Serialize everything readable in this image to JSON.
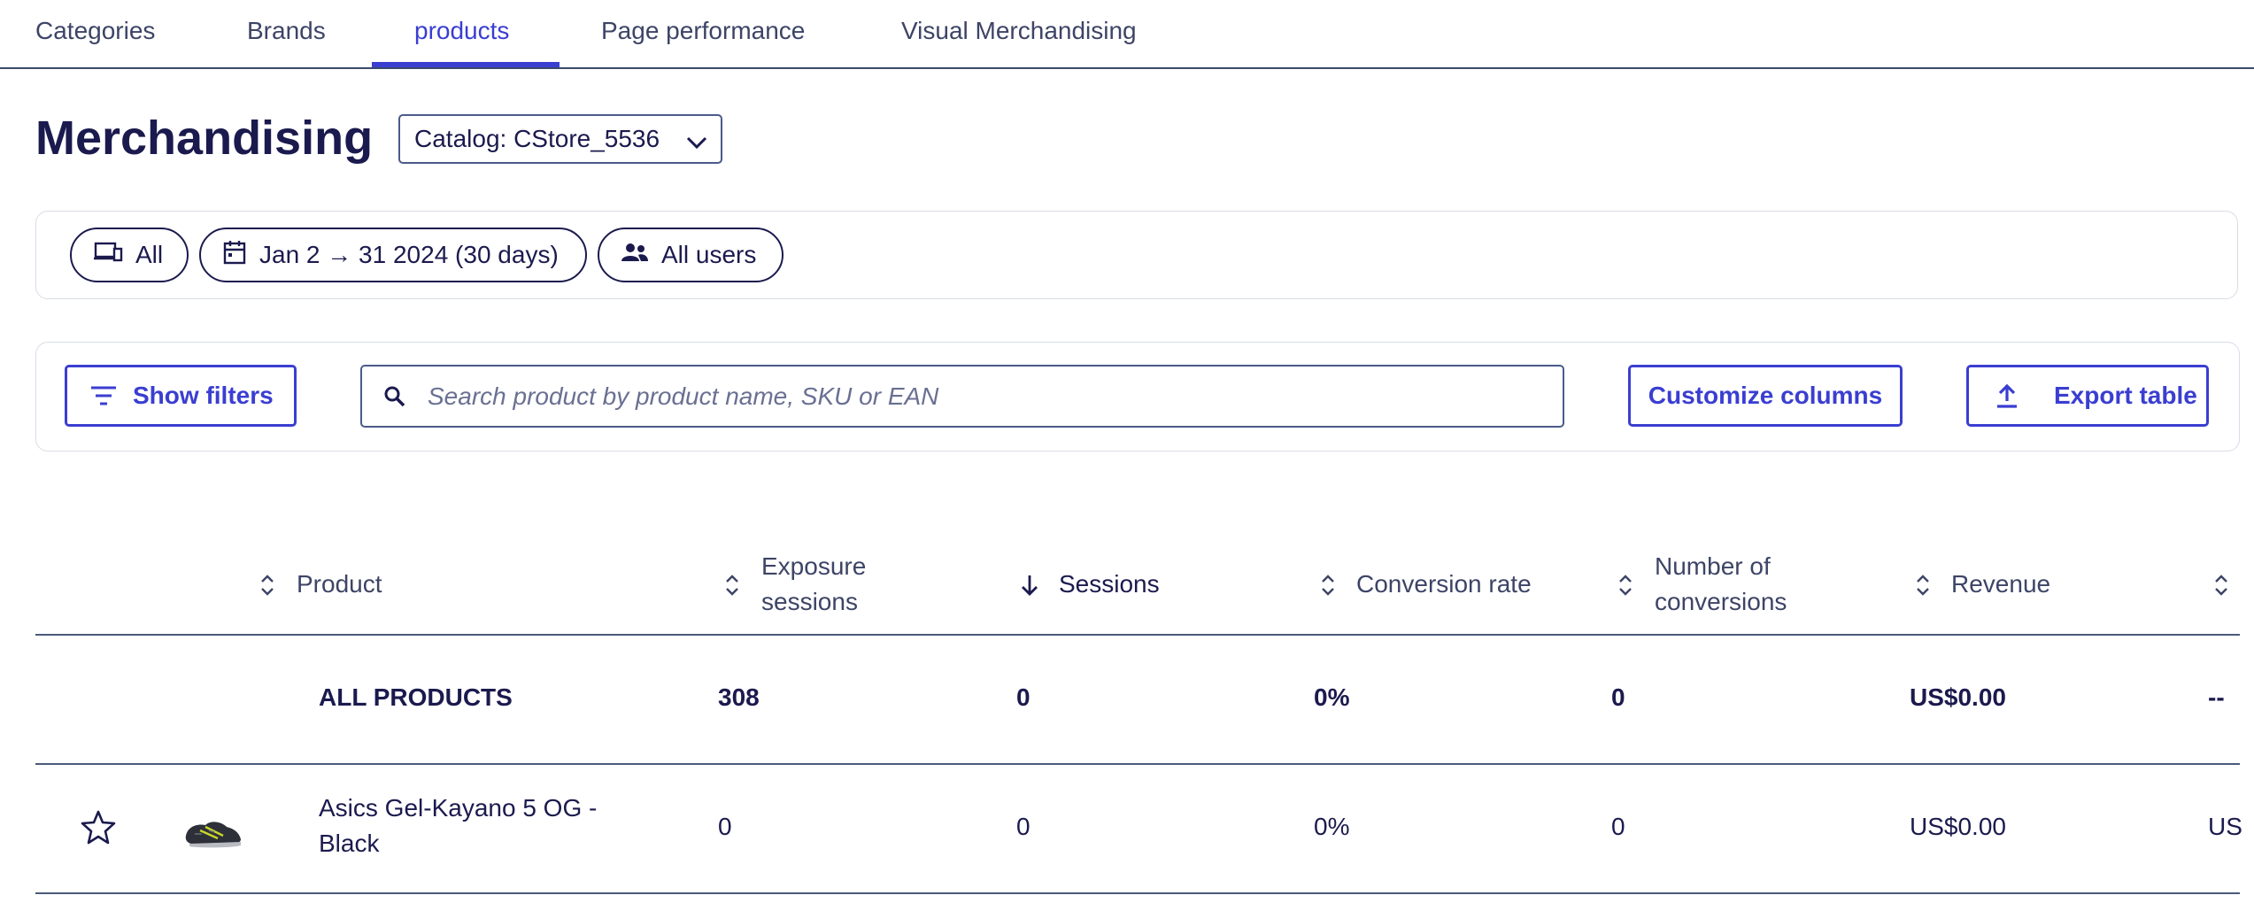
{
  "tabs": [
    {
      "label": "Categories"
    },
    {
      "label": "Brands"
    },
    {
      "label": "products",
      "active": true
    },
    {
      "label": "Page performance"
    },
    {
      "label": "Visual Merchandising"
    }
  ],
  "page": {
    "title": "Merchandising",
    "catalog_label": "Catalog: CStore_5536"
  },
  "filters": {
    "device": "All",
    "date_range": "Jan 2 → 31 2024 (30 days)",
    "audience": "All users"
  },
  "toolbar": {
    "show_filters": "Show filters",
    "search_placeholder": "Search product by product name, SKU or EAN",
    "search_value": "",
    "customize_columns": "Customize columns",
    "export_table": "Export table"
  },
  "table": {
    "columns": [
      {
        "label": "Product",
        "sort": "none"
      },
      {
        "label": "Exposure sessions",
        "sort": "none"
      },
      {
        "label": "Sessions",
        "sort": "descending"
      },
      {
        "label": "Conversion rate",
        "sort": "none"
      },
      {
        "label": "Number of conversions",
        "sort": "none"
      },
      {
        "label": "Revenue",
        "sort": "none"
      }
    ],
    "summary_row": {
      "product": "ALL PRODUCTS",
      "exposure_sessions": "308",
      "sessions": "0",
      "conversion_rate": "0%",
      "conversions": "0",
      "revenue": "US$0.00",
      "next_col": "--"
    },
    "rows": [
      {
        "product": "Asics Gel-Kayano 5 OG - Black",
        "thumbnail": "black-sneaker-image",
        "favorite": false,
        "exposure_sessions": "0",
        "sessions": "0",
        "conversion_rate": "0%",
        "conversions": "0",
        "revenue": "US$0.00",
        "next_col": "US"
      }
    ]
  },
  "colors": {
    "accent": "#3a3ed1",
    "text_dark": "#1b1a4e",
    "text_muted": "#3d4466",
    "border": "#d9dce6"
  }
}
